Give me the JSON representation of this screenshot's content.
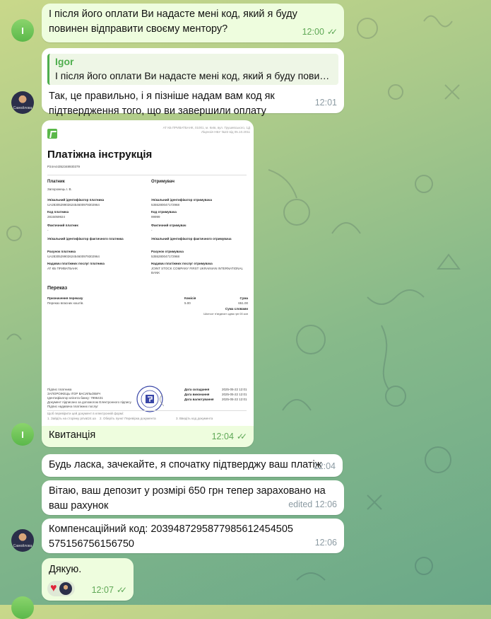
{
  "messages": {
    "m1": {
      "text": "І після його оплати Ви надасте мені код, який я буду повинен відправити своєму ментору?",
      "time": "12:00"
    },
    "m2": {
      "reply_name": "Igor",
      "reply_text": "І після його оплати Ви надасте мені код, який я буду повине…",
      "text": "Так, це правильно, і я пізніше надам вам код як підтвердження того, що ви завершили оплату",
      "time": "12:01"
    },
    "m3": {
      "caption": "Квитанція",
      "time": "12:04"
    },
    "m4": {
      "text": "Будь ласка, зачекайте, я спочатку підтверджу ваш платіж",
      "time": "12:04"
    },
    "m5": {
      "text": "Вітаю, ваш депозит у розмірі 650 грн тепер зараховано на ваш рахунок",
      "time": "edited 12:06"
    },
    "m6": {
      "text": "Компенсаційний код: 2039487295877985612454505575156756156750",
      "time": "12:06"
    },
    "m7": {
      "text": "Дякую.",
      "time": "12:07"
    }
  },
  "avatars": {
    "user_initial": "I",
    "peer_label": "Самойлова"
  },
  "document": {
    "title": "Платіжна інструкція",
    "doc_number": "P24A44352348930379",
    "header_right_1": "АТ КБ ПРИВАТБАНК, 01001, м. Київ, вул. Грушевського, 1Д",
    "header_right_2": "Ліцензія НБУ №22 від 05.10.2011",
    "payer_title": "Платник",
    "payer_name": "Запорожець І. В.",
    "receiver_title": "Отримувач",
    "payer_id_label": "Унікальний ідентифікатор платника",
    "payer_id": "UA283052990262454600979302964",
    "payer_code_label": "Код платника",
    "payer_code": "2815059924",
    "actual_payer_label": "Фактичний платник",
    "actual_payer": "-",
    "actual_payer_id_label": "Унікальний ідентифікатор фактичного платника",
    "payer_account_label": "Рахунок платника",
    "payer_account": "UA283052990262454600979302964",
    "payer_bank_label": "Надавач платіжних послуг платника",
    "payer_bank": "АТ КБ ПРИВАТБАНК",
    "recv_id_label": "Унікальний ідентифікатор отримувача",
    "recv_id": "5355280047172968",
    "recv_code_label": "Код отримувача",
    "recv_code": "99999",
    "actual_recv_label": "Фактичний отримувач",
    "actual_recv": "-",
    "actual_recv_id_label": "Унікальний ідентифікатор фактичного отримувача",
    "recv_account_label": "Рахунок отримувача",
    "recv_account": "5355280047172968",
    "recv_bank_label": "Надавач платіжних послуг отримувача",
    "recv_bank": "JOINT STOCK COMPANY FIRST UKRAINIAN INTERNATIONAL BANK",
    "transfer_title": "Переказ",
    "purpose_label": "Призначення переказу",
    "purpose": "Переказ власних коштів.",
    "fee_label": "Комісія",
    "fee": "5.00",
    "sum_label": "Сума",
    "sum": "651.00",
    "sum_words_label": "Сума словами",
    "sum_words": "Шістсот п'ятдесят одна грн 00 коп",
    "sign_1": "Підпис платника",
    "sign_2": "ЗАПОРОЖЕЦЬ ІГОР ВАСИЛЬОВИЧ",
    "sign_3": "Ідентифікатор клієнта банку: 7996431",
    "sign_4": "Документ підписано за допомогою Електронного підпису",
    "sign_5": "Підпис надавача платіжних послуг",
    "date_created_label": "Дата складання",
    "date_created": "2025-05-22 12:01",
    "date_exec_label": "Дата виконання",
    "date_exec": "2025-05-22 12:01",
    "date_valid_label": "Дата валютування",
    "date_valid": "2025-05-22 12:01",
    "footer_1": "Щоб перевірити цей документ в електронній формі:",
    "footer_2": "1. Зайдіть на сторінку privat24.ua",
    "footer_3": "2. Оберіть пункт Перевірка документа",
    "footer_4": "3. Введіть код документа"
  },
  "colors": {
    "outgoing": "#eefdde",
    "incoming": "#ffffff",
    "accent": "#4fae4e",
    "brand": "#5bb84a"
  }
}
